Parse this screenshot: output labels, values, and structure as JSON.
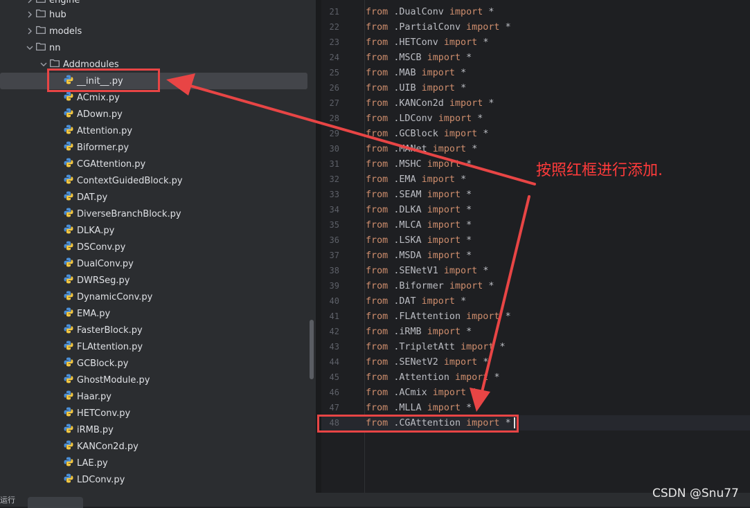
{
  "tree": {
    "rows": [
      {
        "label": "engine",
        "level": 1,
        "type": "folder",
        "chevron": "right"
      },
      {
        "label": "hub",
        "level": 1,
        "type": "folder",
        "chevron": "right"
      },
      {
        "label": "models",
        "level": 1,
        "type": "folder",
        "chevron": "right"
      },
      {
        "label": "nn",
        "level": 1,
        "type": "folder",
        "chevron": "down"
      },
      {
        "label": "Addmodules",
        "level": 2,
        "type": "folder",
        "chevron": "down"
      },
      {
        "label": "__init__.py",
        "level": 3,
        "type": "py",
        "selected": true
      },
      {
        "label": "ACmix.py",
        "level": 3,
        "type": "py"
      },
      {
        "label": "ADown.py",
        "level": 3,
        "type": "py"
      },
      {
        "label": "Attention.py",
        "level": 3,
        "type": "py"
      },
      {
        "label": "Biformer.py",
        "level": 3,
        "type": "py"
      },
      {
        "label": "CGAttention.py",
        "level": 3,
        "type": "py"
      },
      {
        "label": "ContextGuidedBlock.py",
        "level": 3,
        "type": "py"
      },
      {
        "label": "DAT.py",
        "level": 3,
        "type": "py"
      },
      {
        "label": "DiverseBranchBlock.py",
        "level": 3,
        "type": "py"
      },
      {
        "label": "DLKA.py",
        "level": 3,
        "type": "py"
      },
      {
        "label": "DSConv.py",
        "level": 3,
        "type": "py"
      },
      {
        "label": "DualConv.py",
        "level": 3,
        "type": "py"
      },
      {
        "label": "DWRSeg.py",
        "level": 3,
        "type": "py"
      },
      {
        "label": "DynamicConv.py",
        "level": 3,
        "type": "py"
      },
      {
        "label": "EMA.py",
        "level": 3,
        "type": "py"
      },
      {
        "label": "FasterBlock.py",
        "level": 3,
        "type": "py"
      },
      {
        "label": "FLAttention.py",
        "level": 3,
        "type": "py"
      },
      {
        "label": "GCBlock.py",
        "level": 3,
        "type": "py"
      },
      {
        "label": "GhostModule.py",
        "level": 3,
        "type": "py"
      },
      {
        "label": "Haar.py",
        "level": 3,
        "type": "py"
      },
      {
        "label": "HETConv.py",
        "level": 3,
        "type": "py"
      },
      {
        "label": "iRMB.py",
        "level": 3,
        "type": "py"
      },
      {
        "label": "KANCon2d.py",
        "level": 3,
        "type": "py"
      },
      {
        "label": "LAE.py",
        "level": 3,
        "type": "py"
      },
      {
        "label": "LDConv.py",
        "level": 3,
        "type": "py"
      }
    ]
  },
  "editor": {
    "keyword_from": "from",
    "keyword_import": "import",
    "star": "*",
    "lines": [
      {
        "n": "21",
        "module": ".DualConv"
      },
      {
        "n": "22",
        "module": ".PartialConv"
      },
      {
        "n": "23",
        "module": ".HETConv"
      },
      {
        "n": "24",
        "module": ".MSCB"
      },
      {
        "n": "25",
        "module": ".MAB"
      },
      {
        "n": "26",
        "module": ".UIB"
      },
      {
        "n": "27",
        "module": ".KANCon2d"
      },
      {
        "n": "28",
        "module": ".LDConv"
      },
      {
        "n": "29",
        "module": ".GCBlock"
      },
      {
        "n": "30",
        "module": ".MANet"
      },
      {
        "n": "31",
        "module": ".MSHC"
      },
      {
        "n": "32",
        "module": ".EMA"
      },
      {
        "n": "33",
        "module": ".SEAM"
      },
      {
        "n": "34",
        "module": ".DLKA"
      },
      {
        "n": "35",
        "module": ".MLCA"
      },
      {
        "n": "36",
        "module": ".LSKA"
      },
      {
        "n": "37",
        "module": ".MSDA"
      },
      {
        "n": "38",
        "module": ".SENetV1"
      },
      {
        "n": "39",
        "module": ".Biformer"
      },
      {
        "n": "40",
        "module": ".DAT"
      },
      {
        "n": "41",
        "module": ".FLAttention"
      },
      {
        "n": "42",
        "module": ".iRMB"
      },
      {
        "n": "43",
        "module": ".TripletAtt"
      },
      {
        "n": "44",
        "module": ".SENetV2"
      },
      {
        "n": "45",
        "module": ".Attention"
      },
      {
        "n": "46",
        "module": ".ACmix"
      },
      {
        "n": "47",
        "module": ".MLLA"
      },
      {
        "n": "48",
        "module": ".CGAttention",
        "current": true
      }
    ]
  },
  "annotation": {
    "text": "按照红框进行添加."
  },
  "status": {
    "left_text": "运行"
  },
  "watermark": {
    "text": "CSDN @Snu77"
  },
  "colors": {
    "sidebar_bg": "#2b2d30",
    "editor_bg": "#1e1f22",
    "keyword": "#cf8e6d",
    "text": "#bcbec4",
    "red": "#e84545"
  }
}
